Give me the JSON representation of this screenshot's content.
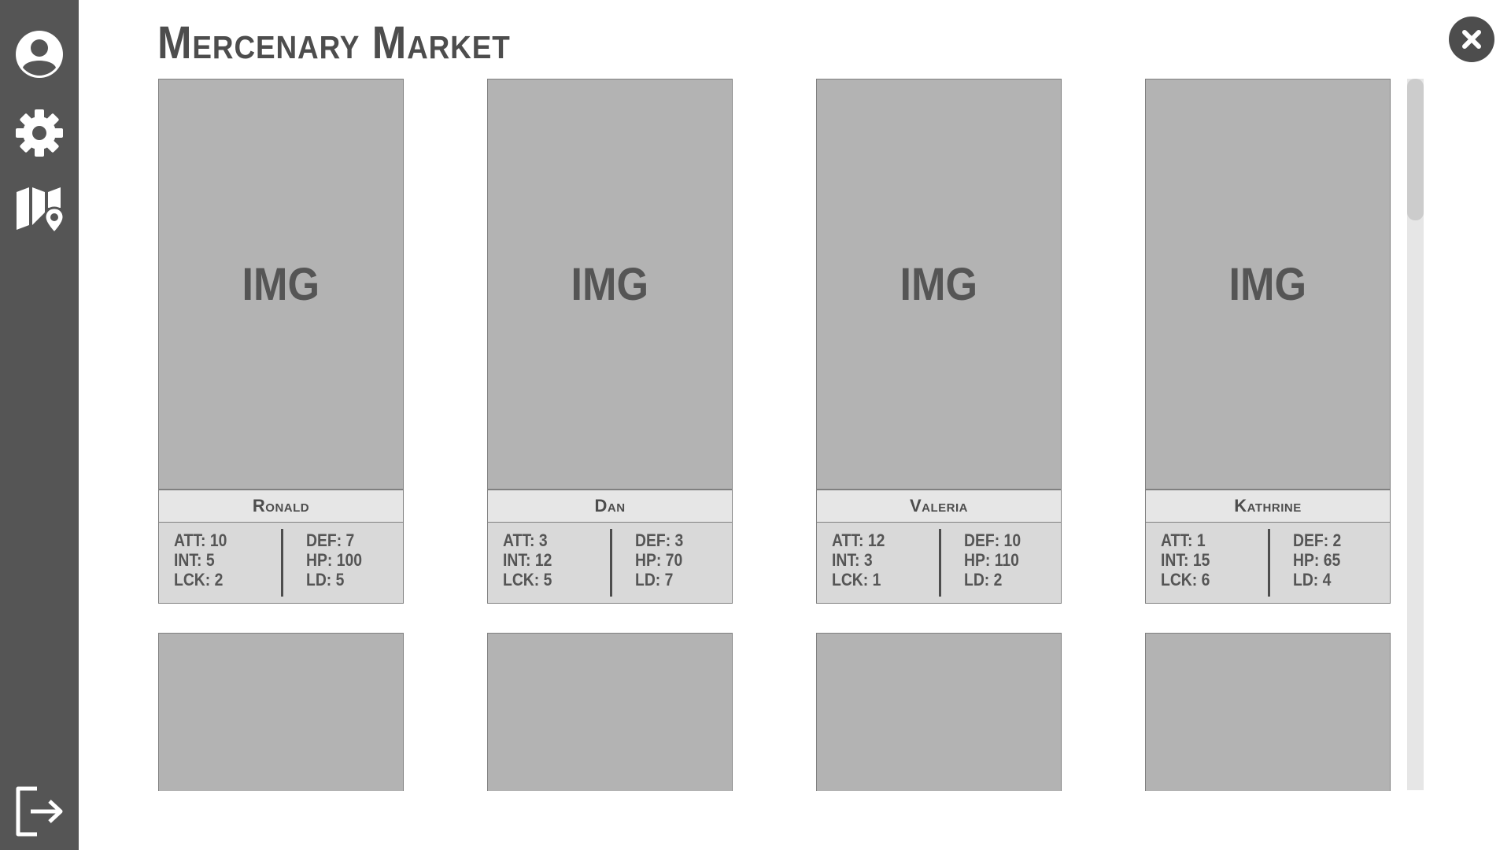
{
  "page": {
    "title": "Mercenary Market"
  },
  "sidebar": {
    "items": [
      {
        "icon": "user-profile-icon"
      },
      {
        "icon": "gear-icon"
      },
      {
        "icon": "map-location-icon"
      },
      {
        "icon": "logout-icon"
      }
    ]
  },
  "close_button": {
    "icon": "close-icon"
  },
  "image_placeholder": "IMG",
  "mercenaries": [
    {
      "name": "Ronald",
      "stats_left": [
        "ATT: 10",
        "INT: 5",
        "LCK: 2"
      ],
      "stats_right": [
        "DEF: 7",
        "HP: 100",
        "LD: 5"
      ]
    },
    {
      "name": "Dan",
      "stats_left": [
        "ATT: 3",
        "INT: 12",
        "LCK: 5"
      ],
      "stats_right": [
        "DEF: 3",
        "HP: 70",
        "LD: 7"
      ]
    },
    {
      "name": "Valeria",
      "stats_left": [
        "ATT: 12",
        "INT: 3",
        "LCK: 1"
      ],
      "stats_right": [
        "DEF: 10",
        "HP: 110",
        "LD: 2"
      ]
    },
    {
      "name": "Kathrine",
      "stats_left": [
        "ATT: 1",
        "INT: 15",
        "LCK: 6"
      ],
      "stats_right": [
        "DEF: 2",
        "HP: 65",
        "LD: 4"
      ]
    }
  ],
  "colors": {
    "sidebar": "#555555",
    "placeholder": "#b3b3b3",
    "name_bar": "#e6e6e6",
    "stats_panel": "#d9d9d9",
    "text": "#4d4d4d"
  }
}
